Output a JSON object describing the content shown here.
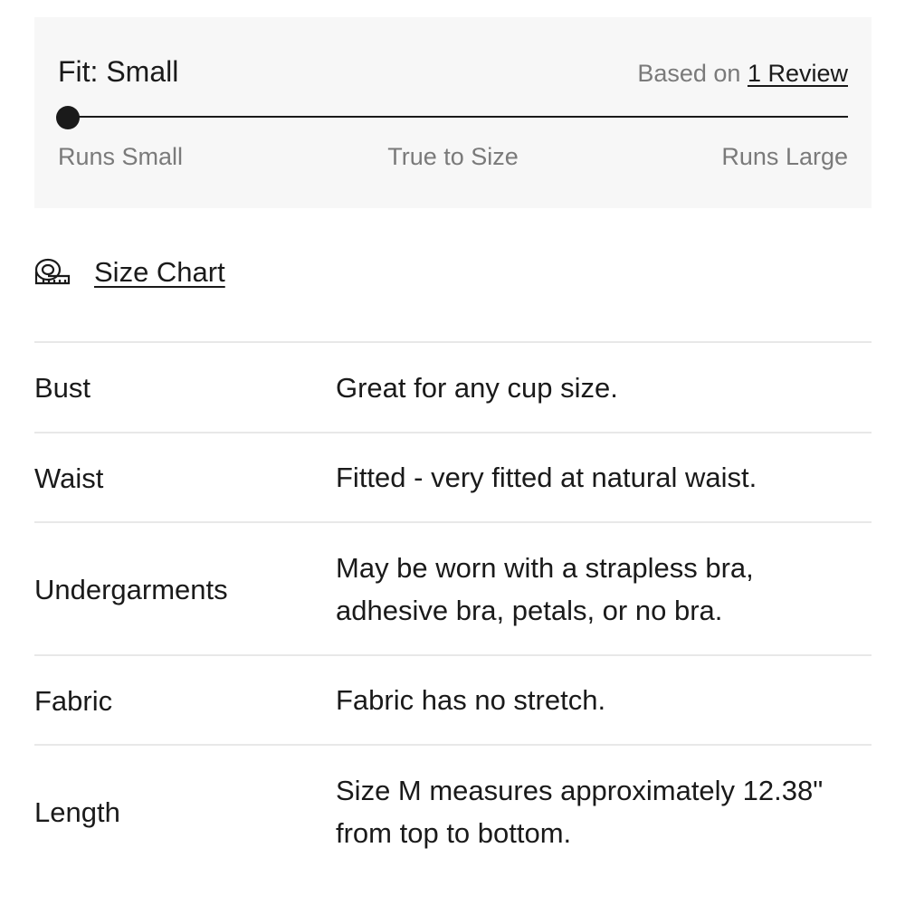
{
  "fit": {
    "title": "Fit: Small",
    "based_on_prefix": "Based on ",
    "review_link": "1 Review",
    "slider_value_percent": 0,
    "scale": {
      "left": "Runs Small",
      "middle": "True to Size",
      "right": "Runs Large"
    }
  },
  "size_chart": {
    "icon": "measuring-tape-icon",
    "label": "Size Chart"
  },
  "details": [
    {
      "label": "Bust",
      "value": "Great for any cup size."
    },
    {
      "label": "Waist",
      "value": "Fitted - very fitted at natural waist."
    },
    {
      "label": "Undergarments",
      "value": "May be worn with a strapless bra, adhesive bra, petals, or no bra."
    },
    {
      "label": "Fabric",
      "value": "Fabric has no stretch."
    },
    {
      "label": "Length",
      "value": "Size M measures approximately 12.38\" from top to bottom."
    }
  ]
}
